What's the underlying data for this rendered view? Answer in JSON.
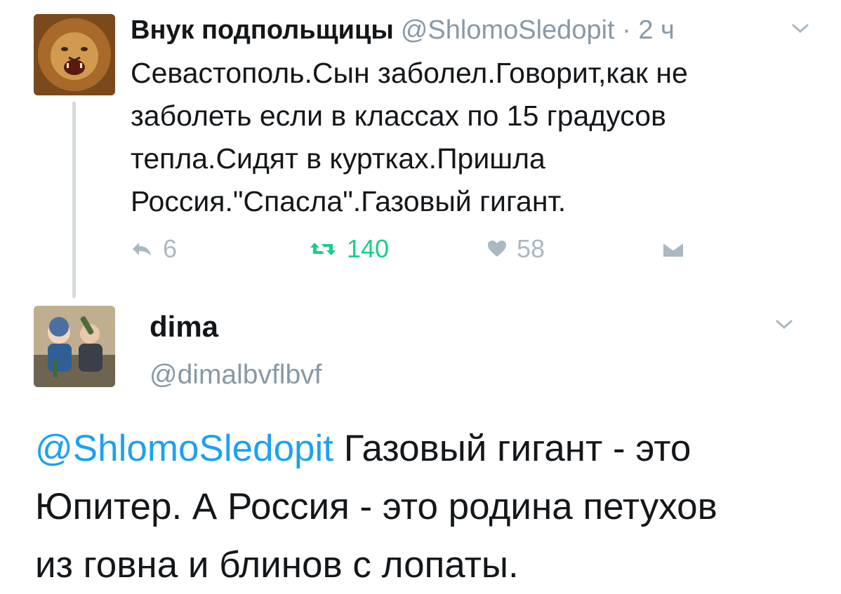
{
  "tweet1": {
    "display_name": "Внук подпольщицы",
    "meta": "@ShlomoSledopit · 2 ч",
    "text_lines": [
      "Севастополь.Сын заболел.Говорит,как не",
      "заболеть если в классах по 15 градусов",
      "тепла.Сидят в куртках.Пришла",
      "Россия.\"Спасла\".Газовый гигант."
    ],
    "reply_count": "6",
    "retweet_count": "140",
    "like_count": "58"
  },
  "tweet2": {
    "display_name": "dima",
    "handle": "@dimalbvflbvf",
    "mention": "@ShlomoSledopit",
    "text_line1_rest": " Газовый гигант - это",
    "text_line2": "Юпитер. А Россия - это родина петухов",
    "text_line3": "из говна и блинов с лопаты."
  },
  "colors": {
    "mention": "#1da1f2",
    "retweet_active": "#19cf86",
    "muted": "#8899a6",
    "icon_muted": "#aab8c2"
  },
  "icons": [
    "lion-avatar-icon",
    "kids-avatar-icon",
    "chevron-down-icon",
    "reply-icon",
    "retweet-icon",
    "heart-icon",
    "direct-message-icon"
  ]
}
